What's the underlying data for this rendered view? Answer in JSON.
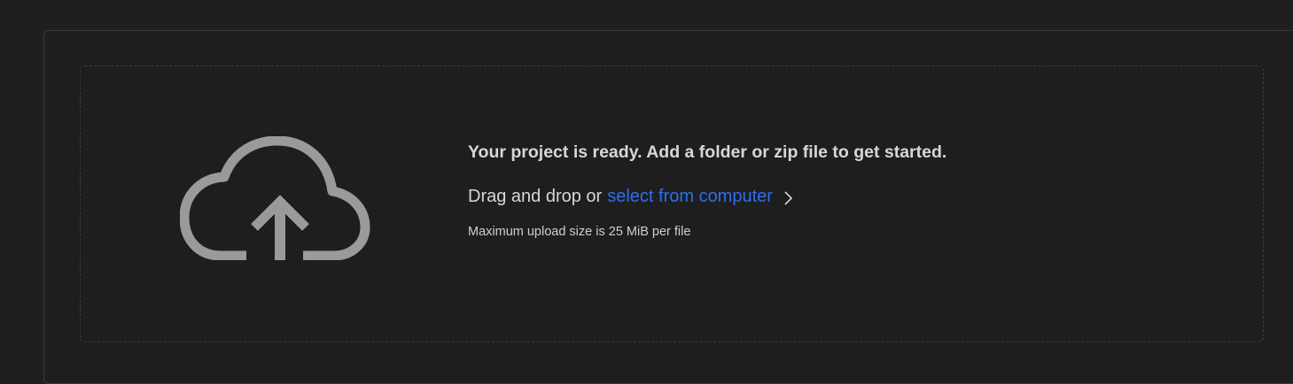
{
  "upload": {
    "headline": "Your project is ready. Add a folder or zip file to get started.",
    "drag_prefix": "Drag and drop or",
    "select_link": "select from computer",
    "size_note": "Maximum upload size is 25 MiB per file",
    "icon": "cloud-upload-icon",
    "link_icon": "chevron-right-icon"
  },
  "colors": {
    "background": "#1f1f1f",
    "link": "#2f6df0",
    "icon": "#9a9a9a",
    "text": "#d7d7d7"
  }
}
